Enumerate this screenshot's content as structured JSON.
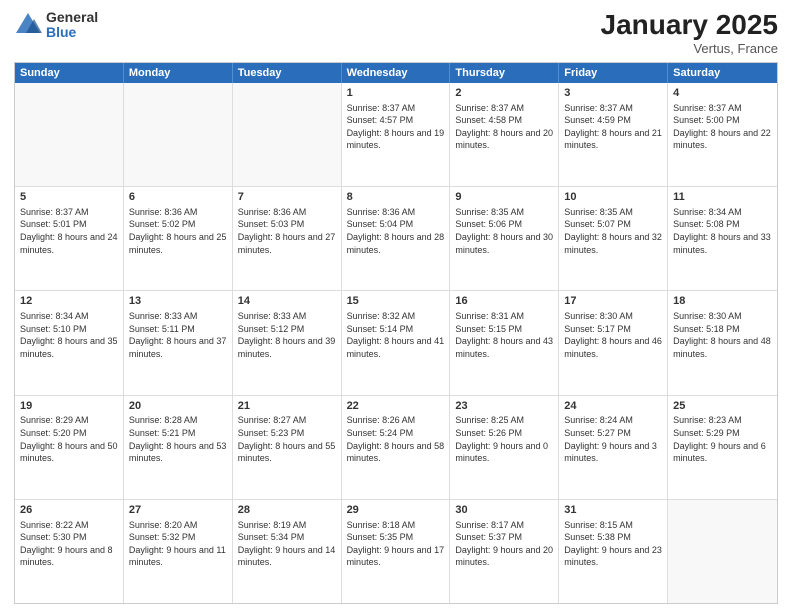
{
  "logo": {
    "general": "General",
    "blue": "Blue"
  },
  "title": "January 2025",
  "location": "Vertus, France",
  "days": [
    "Sunday",
    "Monday",
    "Tuesday",
    "Wednesday",
    "Thursday",
    "Friday",
    "Saturday"
  ],
  "weeks": [
    [
      {
        "day": "",
        "empty": true
      },
      {
        "day": "",
        "empty": true
      },
      {
        "day": "",
        "empty": true
      },
      {
        "day": "1",
        "sunrise": "8:37 AM",
        "sunset": "4:57 PM",
        "daylight": "8 hours and 19 minutes."
      },
      {
        "day": "2",
        "sunrise": "8:37 AM",
        "sunset": "4:58 PM",
        "daylight": "8 hours and 20 minutes."
      },
      {
        "day": "3",
        "sunrise": "8:37 AM",
        "sunset": "4:59 PM",
        "daylight": "8 hours and 21 minutes."
      },
      {
        "day": "4",
        "sunrise": "8:37 AM",
        "sunset": "5:00 PM",
        "daylight": "8 hours and 22 minutes."
      }
    ],
    [
      {
        "day": "5",
        "sunrise": "8:37 AM",
        "sunset": "5:01 PM",
        "daylight": "8 hours and 24 minutes."
      },
      {
        "day": "6",
        "sunrise": "8:36 AM",
        "sunset": "5:02 PM",
        "daylight": "8 hours and 25 minutes."
      },
      {
        "day": "7",
        "sunrise": "8:36 AM",
        "sunset": "5:03 PM",
        "daylight": "8 hours and 27 minutes."
      },
      {
        "day": "8",
        "sunrise": "8:36 AM",
        "sunset": "5:04 PM",
        "daylight": "8 hours and 28 minutes."
      },
      {
        "day": "9",
        "sunrise": "8:35 AM",
        "sunset": "5:06 PM",
        "daylight": "8 hours and 30 minutes."
      },
      {
        "day": "10",
        "sunrise": "8:35 AM",
        "sunset": "5:07 PM",
        "daylight": "8 hours and 32 minutes."
      },
      {
        "day": "11",
        "sunrise": "8:34 AM",
        "sunset": "5:08 PM",
        "daylight": "8 hours and 33 minutes."
      }
    ],
    [
      {
        "day": "12",
        "sunrise": "8:34 AM",
        "sunset": "5:10 PM",
        "daylight": "8 hours and 35 minutes."
      },
      {
        "day": "13",
        "sunrise": "8:33 AM",
        "sunset": "5:11 PM",
        "daylight": "8 hours and 37 minutes."
      },
      {
        "day": "14",
        "sunrise": "8:33 AM",
        "sunset": "5:12 PM",
        "daylight": "8 hours and 39 minutes."
      },
      {
        "day": "15",
        "sunrise": "8:32 AM",
        "sunset": "5:14 PM",
        "daylight": "8 hours and 41 minutes."
      },
      {
        "day": "16",
        "sunrise": "8:31 AM",
        "sunset": "5:15 PM",
        "daylight": "8 hours and 43 minutes."
      },
      {
        "day": "17",
        "sunrise": "8:30 AM",
        "sunset": "5:17 PM",
        "daylight": "8 hours and 46 minutes."
      },
      {
        "day": "18",
        "sunrise": "8:30 AM",
        "sunset": "5:18 PM",
        "daylight": "8 hours and 48 minutes."
      }
    ],
    [
      {
        "day": "19",
        "sunrise": "8:29 AM",
        "sunset": "5:20 PM",
        "daylight": "8 hours and 50 minutes."
      },
      {
        "day": "20",
        "sunrise": "8:28 AM",
        "sunset": "5:21 PM",
        "daylight": "8 hours and 53 minutes."
      },
      {
        "day": "21",
        "sunrise": "8:27 AM",
        "sunset": "5:23 PM",
        "daylight": "8 hours and 55 minutes."
      },
      {
        "day": "22",
        "sunrise": "8:26 AM",
        "sunset": "5:24 PM",
        "daylight": "8 hours and 58 minutes."
      },
      {
        "day": "23",
        "sunrise": "8:25 AM",
        "sunset": "5:26 PM",
        "daylight": "9 hours and 0 minutes."
      },
      {
        "day": "24",
        "sunrise": "8:24 AM",
        "sunset": "5:27 PM",
        "daylight": "9 hours and 3 minutes."
      },
      {
        "day": "25",
        "sunrise": "8:23 AM",
        "sunset": "5:29 PM",
        "daylight": "9 hours and 6 minutes."
      }
    ],
    [
      {
        "day": "26",
        "sunrise": "8:22 AM",
        "sunset": "5:30 PM",
        "daylight": "9 hours and 8 minutes."
      },
      {
        "day": "27",
        "sunrise": "8:20 AM",
        "sunset": "5:32 PM",
        "daylight": "9 hours and 11 minutes."
      },
      {
        "day": "28",
        "sunrise": "8:19 AM",
        "sunset": "5:34 PM",
        "daylight": "9 hours and 14 minutes."
      },
      {
        "day": "29",
        "sunrise": "8:18 AM",
        "sunset": "5:35 PM",
        "daylight": "9 hours and 17 minutes."
      },
      {
        "day": "30",
        "sunrise": "8:17 AM",
        "sunset": "5:37 PM",
        "daylight": "9 hours and 20 minutes."
      },
      {
        "day": "31",
        "sunrise": "8:15 AM",
        "sunset": "5:38 PM",
        "daylight": "9 hours and 23 minutes."
      },
      {
        "day": "",
        "empty": true
      }
    ]
  ]
}
